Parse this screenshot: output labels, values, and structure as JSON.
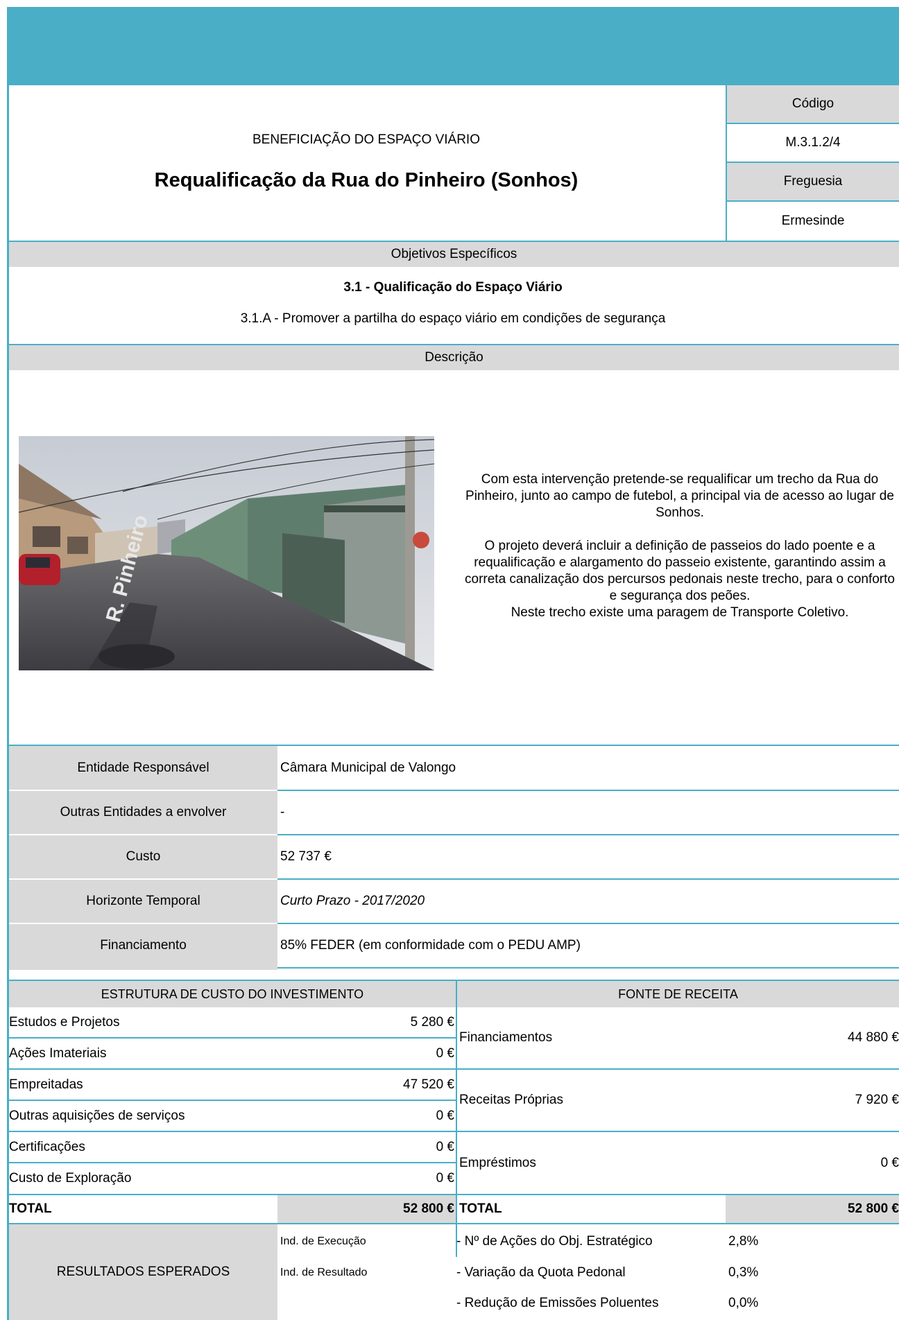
{
  "header": {
    "category": "BENEFICIAÇÃO DO ESPAÇO VIÁRIO",
    "title": "Requalificação da Rua do Pinheiro (Sonhos)",
    "code_label": "Código",
    "code_value": "M.3.1.2/4",
    "parish_label": "Freguesia",
    "parish_value": "Ermesinde"
  },
  "objectives": {
    "heading": "Objetivos Específicos",
    "main": "3.1 - Qualificação do Espaço Viário",
    "sub": "3.1.A - Promover a partilha do espaço viário em condições de segurança"
  },
  "description": {
    "heading": "Descrição",
    "paragraph1": "Com esta intervenção pretende-se requalificar um trecho da Rua do Pinheiro, junto ao campo de futebol, a principal via de acesso ao lugar de Sonhos.",
    "paragraph2": "O projeto deverá incluir a definição de passeios do lado poente e a requalificação e alargamento do passeio existente, garantindo assim a correta canalização dos percursos pedonais neste trecho, para o conforto e segurança dos peões.",
    "paragraph3": "Neste trecho existe uma paragem de Transporte Coletivo.",
    "photo_street_sign": "R. Pinheiro"
  },
  "info": {
    "entity_label": "Entidade Responsável",
    "entity_value": "Câmara Municipal de Valongo",
    "others_label": "Outras Entidades a envolver",
    "others_value": "-",
    "cost_label": "Custo",
    "cost_value": "52 737 €",
    "horizon_label": "Horizonte Temporal",
    "horizon_value": "Curto Prazo - 2017/2020",
    "funding_label": "Financiamento",
    "funding_value": "85% FEDER (em conformidade com o PEDU AMP)"
  },
  "cost_structure": {
    "heading": "ESTRUTURA DE CUSTO DO INVESTIMENTO",
    "rows": [
      {
        "label": "Estudos e Projetos",
        "value": "5 280 €"
      },
      {
        "label": "Ações Imateriais",
        "value": "0 €"
      },
      {
        "label": "Empreitadas",
        "value": "47 520 €"
      },
      {
        "label": "Outras aquisições de serviços",
        "value": "0 €"
      },
      {
        "label": "Certificações",
        "value": "0 €"
      },
      {
        "label": "Custo de Exploração",
        "value": "0 €"
      }
    ],
    "total_label": "TOTAL",
    "total_value": "52 800 €"
  },
  "revenue": {
    "heading": "FONTE DE RECEITA",
    "rows": [
      {
        "label": "Financiamentos",
        "value": "44 880 €"
      },
      {
        "label": "Receitas Próprias",
        "value": "7 920 €"
      },
      {
        "label": "Empréstimos",
        "value": "0 €"
      }
    ],
    "total_label": "TOTAL",
    "total_value": "52 800 €"
  },
  "results": {
    "label": "RESULTADOS ESPERADOS",
    "exec_label": "Ind. de Execução",
    "result_label": "Ind. de Resultado",
    "indicators": [
      {
        "label": "- Nº de Ações do Obj. Estratégico",
        "value": "2,8%"
      },
      {
        "label": "- Variação da Quota Pedonal",
        "value": "0,3%"
      },
      {
        "label": "- Redução de Emissões Poluentes",
        "value": "0,0%"
      }
    ]
  },
  "colors": {
    "accent": "#4aaec6",
    "grey": "#d9d9d9"
  }
}
